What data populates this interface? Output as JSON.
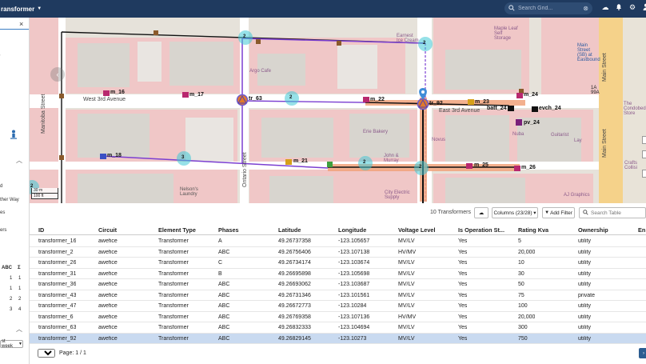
{
  "topbar": {
    "element_dropdown": "ransformer",
    "search_placeholder": "Search Grid...",
    "icons": [
      "search-icon",
      "close-icon",
      "cloud-upload-icon",
      "bell-icon",
      "gear-icon",
      "user-icon"
    ]
  },
  "left_panel": {
    "close": "×",
    "items": [
      "d",
      "ther Way",
      "es",
      "ers"
    ],
    "table_head": [
      "ABC",
      "Σ"
    ],
    "table_rows": [
      [
        "1",
        "1"
      ],
      [
        "1",
        "1"
      ],
      [
        "2",
        "2"
      ],
      [
        "3",
        "4"
      ]
    ],
    "week_dropdown": "st week"
  },
  "map": {
    "scale_top": "30 m",
    "scale_bottom": "100 ft",
    "streets": [
      "West 3rd Avenue",
      "East 3rd Avenue",
      "Manitoba Street",
      "Ontario Street",
      "Main Street",
      "Main Street"
    ],
    "pois": [
      "Argo Cafe",
      "Erie Bakery",
      "Novus",
      "John & Murray",
      "City Electric Supply",
      "Nelson's Laundry",
      "Maple Leaf Self Storage",
      "Guitarist",
      "Lay",
      "AJ Graphics",
      "Crafts Collisi",
      "The Condobed Store",
      "Earnest Ice Cream",
      "Nuba",
      "1A 99A",
      "Main Street (SB) at Eastbound"
    ],
    "labels": [
      "m_16",
      "m_17",
      "tr_63",
      "m_22",
      "tr_92",
      "m_23",
      "m_24",
      "batt_24",
      "evch_24",
      "pv_24",
      "m_18",
      "m_21",
      "m_25",
      "m_26"
    ],
    "badges": [
      "2",
      "2",
      "2",
      "3",
      "2",
      "2",
      "2"
    ],
    "colors": {
      "road": "#ffffff",
      "building": "#d9d6d0",
      "block": "#efc8c8",
      "feeder_purple": "#7b3fd1",
      "feeder_orange": "#f0a070",
      "feeder_black": "#111111",
      "transformer": "#e07a2c",
      "meter": "#b8286e",
      "highlight": "#3fc9d6"
    }
  },
  "toolbar": {
    "count": "10 Transformers",
    "export_icon": "cloud-download-icon",
    "columns_label": "Columns (23/28) ▾",
    "add_filter_label": "Add Filter",
    "search_placeholder": "Search Table"
  },
  "table": {
    "headers": [
      "ID",
      "Circuit",
      "Element Type",
      "Phases",
      "Latitude",
      "Longitude",
      "Voltage Level",
      "Is Operation St...",
      "Rating Kva",
      "Ownership",
      "En"
    ],
    "rows": [
      [
        "transformer_16",
        "awefice",
        "Transformer",
        "A",
        "49.26737358",
        "-123.105657",
        "MV/LV",
        "Yes",
        "5",
        "utility"
      ],
      [
        "transformer_2",
        "awefice",
        "Transformer",
        "ABC",
        "49.26756406",
        "-123.107138",
        "HV/MV",
        "Yes",
        "20,000",
        "utility"
      ],
      [
        "transformer_26",
        "awefice",
        "Transformer",
        "C",
        "49.26734174",
        "-123.103674",
        "MV/LV",
        "Yes",
        "10",
        "utility"
      ],
      [
        "transformer_31",
        "awefice",
        "Transformer",
        "B",
        "49.26695898",
        "-123.105698",
        "MV/LV",
        "Yes",
        "30",
        "utility"
      ],
      [
        "transformer_36",
        "awefice",
        "Transformer",
        "ABC",
        "49.26693062",
        "-123.103687",
        "MV/LV",
        "Yes",
        "50",
        "utility"
      ],
      [
        "transformer_43",
        "awefice",
        "Transformer",
        "ABC",
        "49.26731346",
        "-123.101561",
        "MV/LV",
        "Yes",
        "75",
        "private"
      ],
      [
        "transformer_47",
        "awefice",
        "Transformer",
        "ABC",
        "49.26672773",
        "-123.10284",
        "MV/LV",
        "Yes",
        "100",
        "utility"
      ],
      [
        "transformer_6",
        "awefice",
        "Transformer",
        "ABC",
        "49.26769358",
        "-123.107136",
        "HV/MV",
        "Yes",
        "20,000",
        "utility"
      ],
      [
        "transformer_63",
        "awefice",
        "Transformer",
        "ABC",
        "49.26832333",
        "-123.104694",
        "MV/LV",
        "Yes",
        "300",
        "utility"
      ],
      [
        "transformer_92",
        "awefice",
        "Transformer",
        "ABC",
        "49.26829145",
        "-123.10273",
        "MV/LV",
        "Yes",
        "750",
        "utility"
      ]
    ],
    "selected_row": 9
  },
  "pager": {
    "page_size": "10",
    "page_label": "Page: 1 / 1"
  }
}
